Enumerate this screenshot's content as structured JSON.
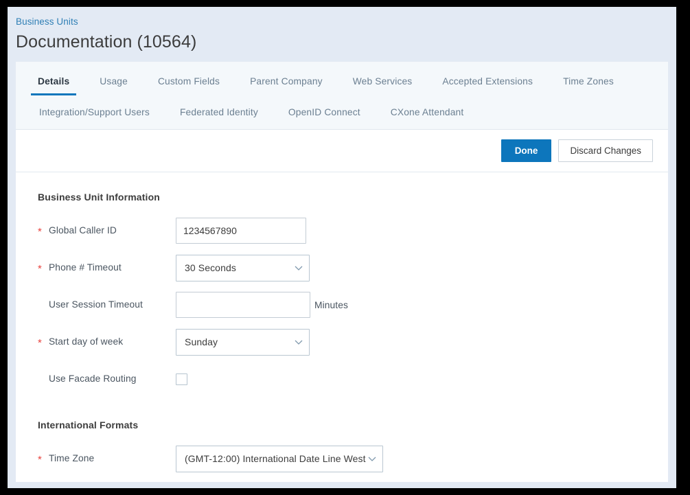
{
  "header": {
    "breadcrumb": "Business Units",
    "title": "Documentation (10564)"
  },
  "tabs": {
    "row1": [
      {
        "label": "Details",
        "active": true
      },
      {
        "label": "Usage",
        "active": false
      },
      {
        "label": "Custom Fields",
        "active": false
      },
      {
        "label": "Parent Company",
        "active": false
      },
      {
        "label": "Web Services",
        "active": false
      },
      {
        "label": "Accepted Extensions",
        "active": false
      },
      {
        "label": "Time Zones",
        "active": false
      }
    ],
    "row2": [
      {
        "label": "Integration/Support Users",
        "active": false
      },
      {
        "label": "Federated Identity",
        "active": false
      },
      {
        "label": "OpenID Connect",
        "active": false
      },
      {
        "label": "CXone Attendant",
        "active": false
      }
    ]
  },
  "actions": {
    "done_label": "Done",
    "discard_label": "Discard Changes"
  },
  "sections": {
    "business_unit_information": "Business Unit Information",
    "international_formats": "International Formats"
  },
  "fields": {
    "global_caller_id": {
      "label": "Global Caller ID",
      "required_mark": "*",
      "value": "1234567890",
      "placeholder": ""
    },
    "phone_timeout": {
      "label": "Phone # Timeout",
      "required_mark": "*",
      "value": "30 Seconds"
    },
    "user_session_timeout": {
      "label": "User Session Timeout",
      "required_mark": "",
      "value": "",
      "placeholder": "",
      "suffix": "Minutes"
    },
    "start_day_of_week": {
      "label": "Start day of week",
      "required_mark": "*",
      "value": "Sunday"
    },
    "use_facade_routing": {
      "label": "Use Facade Routing",
      "required_mark": "",
      "checked": false
    },
    "time_zone": {
      "label": "Time Zone",
      "required_mark": "*",
      "value": "(GMT-12:00) International Date Line West"
    }
  },
  "colors": {
    "accent_blue": "#0d76bc",
    "link_blue": "#2f7fb5",
    "required_red": "#e8433f",
    "page_bg": "#e3eaf4",
    "tab_bg": "#f4f8fb"
  }
}
